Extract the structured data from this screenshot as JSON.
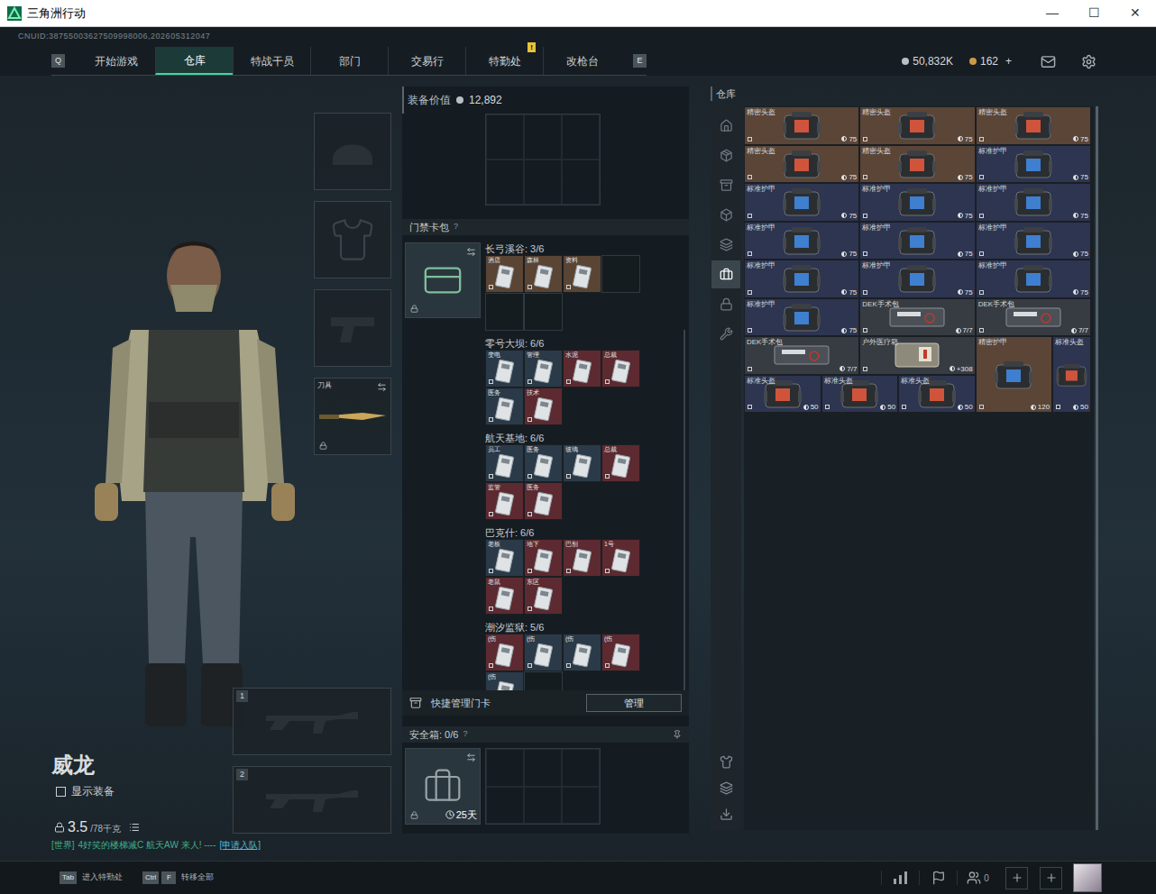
{
  "window": {
    "title": "三角洲行动",
    "controls": [
      "—",
      "☐",
      "✕"
    ]
  },
  "uid": "CNUID:38755003627509998006,202605312047",
  "nav": {
    "left_key": "Q",
    "right_key": "E",
    "tabs": [
      {
        "label": "开始游戏",
        "selected": false,
        "badge": ""
      },
      {
        "label": "仓库",
        "selected": true,
        "badge": ""
      },
      {
        "label": "特战干员",
        "selected": false,
        "badge": ""
      },
      {
        "label": "部门",
        "selected": false,
        "badge": ""
      },
      {
        "label": "交易行",
        "selected": false,
        "badge": ""
      },
      {
        "label": "特勤处",
        "selected": false,
        "badge": "!"
      },
      {
        "label": "改枪台",
        "selected": false,
        "badge": ""
      }
    ]
  },
  "currency": [
    {
      "value": "50,832K",
      "plus": ""
    },
    {
      "value": "162",
      "plus": "+"
    }
  ],
  "operator": {
    "name": "威龙",
    "show_equipment": {
      "label": "显示装备",
      "checked": false
    },
    "weight": "3.5",
    "capacity": "/78千克"
  },
  "chat": {
    "channel": "[世界]",
    "text": "4好笑的楼梯减C 航天AW  来人! ----",
    "action": "[申请入队]"
  },
  "equipment_slots": [
    {
      "kind": "helmet",
      "label": "",
      "filled": false,
      "locked": false
    },
    {
      "kind": "armor",
      "label": "",
      "filled": false,
      "locked": false
    },
    {
      "kind": "pistol",
      "label": "",
      "filled": false,
      "locked": false
    },
    {
      "kind": "knife",
      "label": "刀具",
      "filled": true,
      "locked": true
    }
  ],
  "weapon_slots": [
    {
      "number": "1"
    },
    {
      "number": "2"
    }
  ],
  "loadout": {
    "value_label": "装备价值",
    "value": "12,892"
  },
  "keycard_pack": {
    "title": "门禁卡包",
    "help": "?",
    "capacity": 6,
    "maps": [
      {
        "name": "长弓溪谷: 3/6",
        "cards": [
          {
            "label": "酒店",
            "color": "#5a4433"
          },
          {
            "label": "森林",
            "color": "#5a4433"
          },
          {
            "label": "资料",
            "color": "#5a4433"
          }
        ]
      },
      {
        "name": "零号大坝: 6/6",
        "cards": [
          {
            "label": "变电",
            "color": "#2b3a48"
          },
          {
            "label": "管理",
            "color": "#2b3a48"
          },
          {
            "label": "水泥",
            "color": "#5c2a30"
          },
          {
            "label": "总裁",
            "color": "#5c2a30"
          },
          {
            "label": "医务",
            "color": "#2b3a48"
          },
          {
            "label": "技术",
            "color": "#5c2a30"
          }
        ]
      },
      {
        "name": "航天基地: 6/6",
        "cards": [
          {
            "label": "员工",
            "color": "#2b3a48"
          },
          {
            "label": "医务",
            "color": "#2b3a48"
          },
          {
            "label": "玻璃",
            "color": "#2b3a48"
          },
          {
            "label": "总裁",
            "color": "#5c2a30"
          },
          {
            "label": "监管",
            "color": "#5c2a30"
          },
          {
            "label": "医务",
            "color": "#5c2a30"
          }
        ]
      },
      {
        "name": "巴克什: 6/6",
        "cards": [
          {
            "label": "老板",
            "color": "#2b3a48"
          },
          {
            "label": "地下",
            "color": "#5c2a30"
          },
          {
            "label": "巴别",
            "color": "#5c2a30"
          },
          {
            "label": "1号",
            "color": "#5c2a30"
          },
          {
            "label": "老鼠",
            "color": "#5c2a30"
          },
          {
            "label": "东区",
            "color": "#5c2a30"
          }
        ]
      },
      {
        "name": "潮汐监狱: 5/6",
        "cards": [
          {
            "label": "(伤",
            "color": "#5c2a30"
          },
          {
            "label": "(伤",
            "color": "#2b3a48"
          },
          {
            "label": "(伤",
            "color": "#2b3a48"
          },
          {
            "label": "(伤",
            "color": "#5c2a30"
          },
          {
            "label": "(伤",
            "color": "#2b3a48"
          }
        ]
      }
    ]
  },
  "quick_manage": {
    "label": "快捷管理门卡",
    "button": "管理"
  },
  "safe_box": {
    "label": "安全箱: 0/6",
    "help": "?",
    "days": "25天"
  },
  "warehouse": {
    "title": "仓库",
    "side_tabs": [
      {
        "selected": false
      },
      {
        "selected": false
      },
      {
        "selected": false
      },
      {
        "selected": false
      },
      {
        "selected": false
      },
      {
        "selected": true
      },
      {
        "selected": false
      },
      {
        "selected": false
      }
    ],
    "items": [
      {
        "name": "精密头盔",
        "value": "75",
        "kind": "helmet",
        "size": "wide",
        "color": "#5b4537"
      },
      {
        "name": "精密头盔",
        "value": "75",
        "kind": "helmet",
        "size": "wide",
        "color": "#5b4537"
      },
      {
        "name": "精密头盔",
        "value": "75",
        "kind": "helmet",
        "size": "wide",
        "color": "#5b4537"
      },
      {
        "name": "精密头盔",
        "value": "75",
        "kind": "helmet",
        "size": "wide",
        "color": "#5b4537"
      },
      {
        "name": "精密头盔",
        "value": "75",
        "kind": "helmet",
        "size": "wide",
        "color": "#5b4537"
      },
      {
        "name": "标准护甲",
        "value": "75",
        "kind": "armor",
        "size": "wide",
        "color": "#2d3550"
      },
      {
        "name": "标准护甲",
        "value": "75",
        "kind": "armor",
        "size": "wide",
        "color": "#2d3550"
      },
      {
        "name": "标准护甲",
        "value": "75",
        "kind": "armor",
        "size": "wide",
        "color": "#2d3550"
      },
      {
        "name": "标准护甲",
        "value": "75",
        "kind": "armor",
        "size": "wide",
        "color": "#2d3550"
      },
      {
        "name": "标准护甲",
        "value": "75",
        "kind": "armor",
        "size": "wide",
        "color": "#2d3550"
      },
      {
        "name": "标准护甲",
        "value": "75",
        "kind": "armor",
        "size": "wide",
        "color": "#2d3550"
      },
      {
        "name": "标准护甲",
        "value": "75",
        "kind": "armor",
        "size": "wide",
        "color": "#2d3550"
      },
      {
        "name": "标准护甲",
        "value": "75",
        "kind": "armor",
        "size": "wide",
        "color": "#2d3550"
      },
      {
        "name": "标准护甲",
        "value": "75",
        "kind": "armor",
        "size": "wide",
        "color": "#2d3550"
      },
      {
        "name": "标准护甲",
        "value": "75",
        "kind": "armor",
        "size": "wide",
        "color": "#2d3550"
      },
      {
        "name": "标准护甲",
        "value": "75",
        "kind": "armor",
        "size": "wide",
        "color": "#2d3550"
      },
      {
        "name": "DEK手术包",
        "value": "7/7",
        "kind": "kit",
        "size": "wide",
        "color": "#363c42"
      },
      {
        "name": "DEK手术包",
        "value": "7/7",
        "kind": "kit",
        "size": "wide",
        "color": "#363c42"
      },
      {
        "name": "DEK手术包",
        "value": "7/7",
        "kind": "kit",
        "size": "wide",
        "color": "#363c42"
      },
      {
        "name": "户外医疗箱",
        "value": "+308",
        "kind": "medbox",
        "size": "wide",
        "color": "#363c42"
      },
      {
        "name": "精密护甲",
        "value": "120",
        "kind": "armor",
        "size": "big",
        "color": "#5b4537"
      },
      {
        "name": "标准头盔",
        "value": "50",
        "kind": "helmet",
        "size": "tall",
        "color": "#2d3550"
      },
      {
        "name": "标准头盔",
        "value": "50",
        "kind": "helmet",
        "size": "medium",
        "color": "#2d3550"
      },
      {
        "name": "标准头盔",
        "value": "50",
        "kind": "helmet",
        "size": "medium",
        "color": "#2d3550"
      },
      {
        "name": "标准头盔",
        "value": "50",
        "kind": "helmet",
        "size": "medium",
        "color": "#2d3550"
      }
    ]
  },
  "bottom_bar": {
    "hints": [
      {
        "keys": [
          "Tab"
        ],
        "label": "进入特勤处"
      },
      {
        "keys": [
          "Ctrl",
          "F"
        ],
        "label": "转移全部"
      }
    ],
    "friends": "0"
  }
}
